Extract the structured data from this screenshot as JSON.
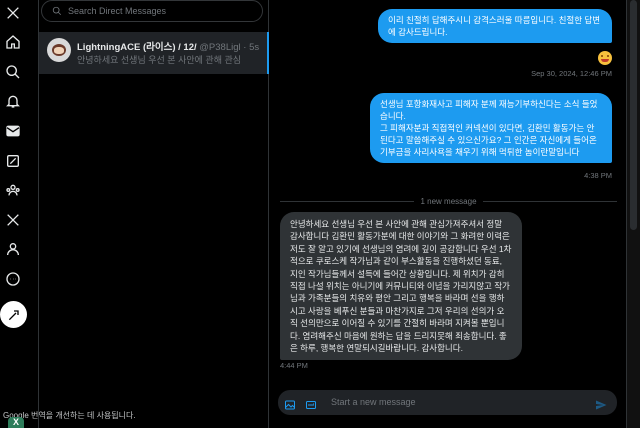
{
  "nav": {
    "items": [
      "x-logo-icon",
      "home-icon",
      "explore-icon",
      "notifications-icon",
      "messages-icon",
      "grok-icon",
      "communities-icon",
      "premium-icon",
      "profile-icon",
      "more-icon"
    ],
    "post_icon": "compose-post-icon"
  },
  "search": {
    "placeholder": "Search Direct Messages"
  },
  "conversation": {
    "name": "LightningACE (라이스) / 12/",
    "handle": "@P38Ligl",
    "time": "· 5s",
    "preview": "안녕하세요 선생님 우선 본 사안에 관해 관심"
  },
  "messages": {
    "out1": "이리 친절히 답해주시니 감격스러울 따름입니다. 친절한 답변에 감사드립니다.",
    "out1_time": "Sep 30, 2024, 12:46 PM",
    "out2": "선생님 포항화재사고 피해자 분께 재능기부하신다는 소식 들었습니다.\n그 피해자분과 직접적인 커넥션이 있다면, 김환민 활동가는 안된다고 말씀해주실 수 있으신가요? 그 인간은 자신에게 들어온 기부금을 사리사욕을 채우기 위해 먹튀한 놈이란말입니다",
    "out2_time": "4:38 PM",
    "divider": "1 new message",
    "in1": "안녕하세요 선생님 우선 본 사안에 관해 관심가져주셔서 정말 감사합니다 김환민 활동가분에 대한 이야기와 그 화려한 이력은 저도 잘 알고 있기에 선생님의 염려에 깊이 공감합니다 우선 1차적으로 쿠로스케 작가님과 같이 부스활동을 진행하셨던 동료, 지인 작가님들께서 설득에 들어간 상황입니다. 제 위치가 감히 직접 나설 위치는 아니기에 커뮤니티와 이념을 가리지않고 작가님과 가족분들의 치유와 평안 그리고 행복을 바라며 선을 행하시고 사랑을 베푸신 분들과 마찬가지로 그저 우리의 선의가 오직 선의만으로 이어질 수 있기를 간절히 바라며 지켜볼 뿐입니다. 염려해주신 마음에 원하는 답을 드리지못해 죄송합니다. 좋은 하루, 행복한 연말되시길바랍니다. 감사합니다.",
    "in1_time": "4:44 PM"
  },
  "composer": {
    "placeholder": "Start a new message"
  },
  "toast": {
    "text": "Google 번역을 개선하는 데 사용됩니다."
  },
  "badge": {
    "label": "X"
  },
  "colors": {
    "accent": "#1d9bf0",
    "background": "#000000",
    "bubble_in": "#2f3336"
  }
}
